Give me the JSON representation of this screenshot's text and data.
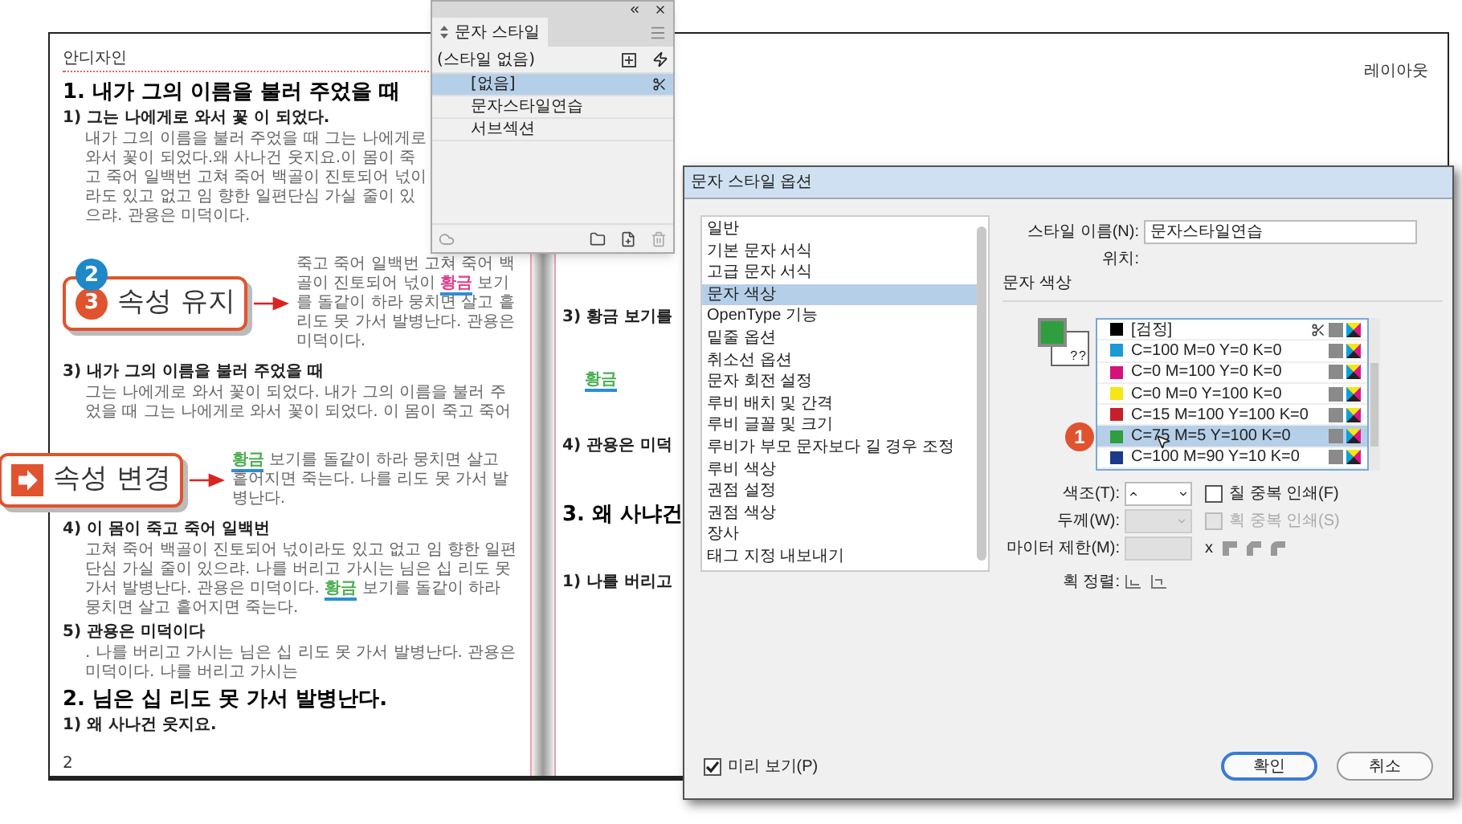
{
  "document": {
    "header_left": "안디자인",
    "header_right": "레이아웃",
    "page_number": "2",
    "left_page": [
      {
        "kind": "h1",
        "text": "1. 내가 그의 이름을 불러 주었을 때"
      },
      {
        "kind": "h2",
        "text": "1) 그는 나에게로 와서 꽃 이 되었다."
      },
      {
        "kind": "p",
        "parts": [
          {
            "text": "내가 그의 이름을 불러 주었을 때 그는 나에게로 와서 꽃이 되었다.왜 사나건 웃지요.이 몸이 죽고 죽어 일백번 고쳐 죽어 백골이 진토되어 넋이라도 있고 없고 임 향한 일편단심 가실 줄이 있으랴. 관용은 미덕이다."
          }
        ]
      },
      {
        "kind": "callout",
        "parts": [
          {
            "text": "죽고 죽어 일백번 고쳐 죽어 백골이 진토되어 넋이 "
          },
          {
            "text": "황금",
            "color": "#e0408a"
          },
          {
            "text": " 보기를 돌같이 하라 뭉치면 살고 흩 리도 못 가서 발병난다. 관용은 미덕이다."
          }
        ]
      },
      {
        "kind": "h2",
        "text": "3) 내가 그의 이름을 불러 주었을 때"
      },
      {
        "kind": "p",
        "parts": [
          {
            "text": "그는 나에게로 와서 꽃이 되었다. 내가 그의 이름을 불러 주었을 때 그는 나에게로 와서 꽃이 되었다. 이 몸이 죽고 죽어"
          }
        ]
      },
      {
        "kind": "callout",
        "parts": [
          {
            "text": "황금",
            "color": "#4caf50"
          },
          {
            "text": " 보기를 돌같이 하라 뭉치면 살고 흩어지면 죽는다. 나를 리도 못 가서 발병난다."
          }
        ]
      },
      {
        "kind": "h2",
        "text": "4) 이 몸이 죽고 죽어 일백번"
      },
      {
        "kind": "p",
        "parts": [
          {
            "text": "고쳐 죽어 백골이 진토되어 넋이라도 있고 없고 임 향한 일편단심 가실 줄이 있으랴. 나를 버리고 가시는 님은 십 리도 못 가서 발병난다. 관용은 미덕이다. "
          },
          {
            "text": "황금",
            "color": "#4caf50"
          },
          {
            "text": " 보기를 돌같이 하라 뭉치면 살고 흩어지면 죽는다."
          }
        ]
      },
      {
        "kind": "h2",
        "text": "5) 관용은 미덕이다"
      },
      {
        "kind": "p",
        "parts": [
          {
            "text": ". 나를 버리고 가시는 님은 십 리도 못 가서 발병난다. 관용은 미덕이다. 나를 버리고 가시는"
          }
        ]
      },
      {
        "kind": "h1",
        "text": "2. 님은 십 리도 못 가서 발병난다."
      },
      {
        "kind": "h2",
        "text": "1) 왜 사나건 웃지요."
      }
    ],
    "right_page": [
      {
        "kind": "h2",
        "text": "3) 황금 보기를"
      },
      {
        "kind": "p",
        "parts": [
          {
            "text": "황금",
            "color": "#4caf50"
          }
        ]
      },
      {
        "kind": "h2",
        "text": "4) 관용은 미덕"
      },
      {
        "kind": "h1",
        "text": "3. 왜 사냐건"
      },
      {
        "kind": "h2",
        "text": "1) 나를 버리고"
      }
    ]
  },
  "callouts": [
    {
      "number": "3",
      "text": "속성 유지",
      "badge": "2"
    },
    {
      "text": "속성 변경"
    }
  ],
  "char_style_panel": {
    "title": "문자 스타일",
    "current": "(스타일 없음)",
    "items": [
      {
        "label": "[없음]",
        "selected": true,
        "noneditable": true
      },
      {
        "label": "문자스타일연습",
        "selected": false,
        "noneditable": false
      },
      {
        "label": "서브섹션",
        "selected": false,
        "noneditable": false
      }
    ]
  },
  "dialog": {
    "title": "문자 스타일 옵션",
    "categories": [
      {
        "label": "일반",
        "selected": false
      },
      {
        "label": "기본 문자 서식",
        "selected": false
      },
      {
        "label": "고급 문자 서식",
        "selected": false
      },
      {
        "label": "문자 색상",
        "selected": true
      },
      {
        "label": "OpenType 기능",
        "selected": false
      },
      {
        "label": "밑줄 옵션",
        "selected": false
      },
      {
        "label": "취소선 옵션",
        "selected": false
      },
      {
        "label": "문자 회전 설정",
        "selected": false
      },
      {
        "label": "루비 배치 및 간격",
        "selected": false
      },
      {
        "label": "루비 글꼴 및 크기",
        "selected": false
      },
      {
        "label": "루비가 부모 문자보다 길 경우 조정",
        "selected": false
      },
      {
        "label": "루비 색상",
        "selected": false
      },
      {
        "label": "권점 설정",
        "selected": false
      },
      {
        "label": "권점 색상",
        "selected": false
      },
      {
        "label": "장사",
        "selected": false
      },
      {
        "label": "태그 지정 내보내기",
        "selected": false
      }
    ],
    "style_name_label": "스타일 이름(N):",
    "style_name": "문자스타일연습",
    "location_label": "위치:",
    "section_title": "문자 색상",
    "stroke_marks": [
      "?",
      "?"
    ],
    "swatches": [
      {
        "label": "[검정]",
        "color": "#000000",
        "selected": false,
        "noneditable": true
      },
      {
        "label": "C=100 M=0 Y=0 K=0",
        "color": "#1a9ad6",
        "selected": false,
        "noneditable": false
      },
      {
        "label": "C=0 M=100 Y=0 K=0",
        "color": "#d6127a",
        "selected": false,
        "noneditable": false
      },
      {
        "label": "C=0 M=0 Y=100 K=0",
        "color": "#f5e614",
        "selected": false,
        "noneditable": false
      },
      {
        "label": "C=15 M=100 Y=100 K=0",
        "color": "#c8202a",
        "selected": false,
        "noneditable": false
      },
      {
        "label": "C=75 M=5 Y=100 K=0",
        "color": "#2e9e3e",
        "selected": true,
        "noneditable": false
      },
      {
        "label": "C=100 M=90 Y=10 K=0",
        "color": "#1b3a8a",
        "selected": false,
        "noneditable": false
      }
    ],
    "swatch_badge": "1",
    "tint_label": "색조(T):",
    "weight_label": "두께(W):",
    "miter_label": "마이터 제한(M):",
    "miter_x": "x",
    "align_label": "획 정렬:",
    "overprint_fill": {
      "label": "칠 중복 인쇄(F)",
      "checked": false,
      "disabled": false
    },
    "overprint_stroke": {
      "label": "획 중복 인쇄(S)",
      "checked": false,
      "disabled": true
    },
    "preview": {
      "label": "미리 보기(P)",
      "checked": true
    },
    "buttons": [
      {
        "label": "확인",
        "default": true
      },
      {
        "label": "취소",
        "default": false
      }
    ]
  }
}
